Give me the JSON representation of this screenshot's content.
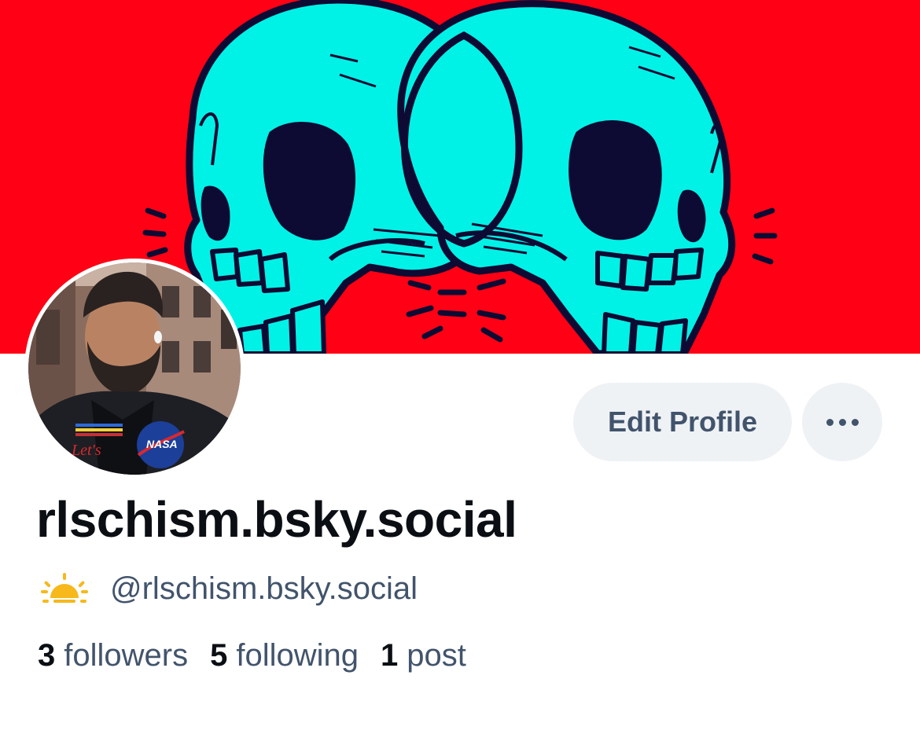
{
  "profile": {
    "display_name": "rlschism.bsky.social",
    "handle": "@rlschism.bsky.social",
    "handle_icon": "sunrise-emoji-icon"
  },
  "actions": {
    "edit_profile_label": "Edit Profile",
    "more_icon": "more-horizontal-icon"
  },
  "stats": {
    "followers_count": "3",
    "followers_label": "followers",
    "following_count": "5",
    "following_label": "following",
    "posts_count": "1",
    "posts_label": "post"
  },
  "banner": {
    "background_color": "#ff0014",
    "skull_color": "#00f2e6",
    "outline_color": "#0d0a33"
  },
  "avatar": {
    "patch_text": "NASA"
  },
  "colors": {
    "text_primary": "#0b0f14",
    "text_secondary": "#42546c",
    "button_bg": "#eff2f5"
  }
}
